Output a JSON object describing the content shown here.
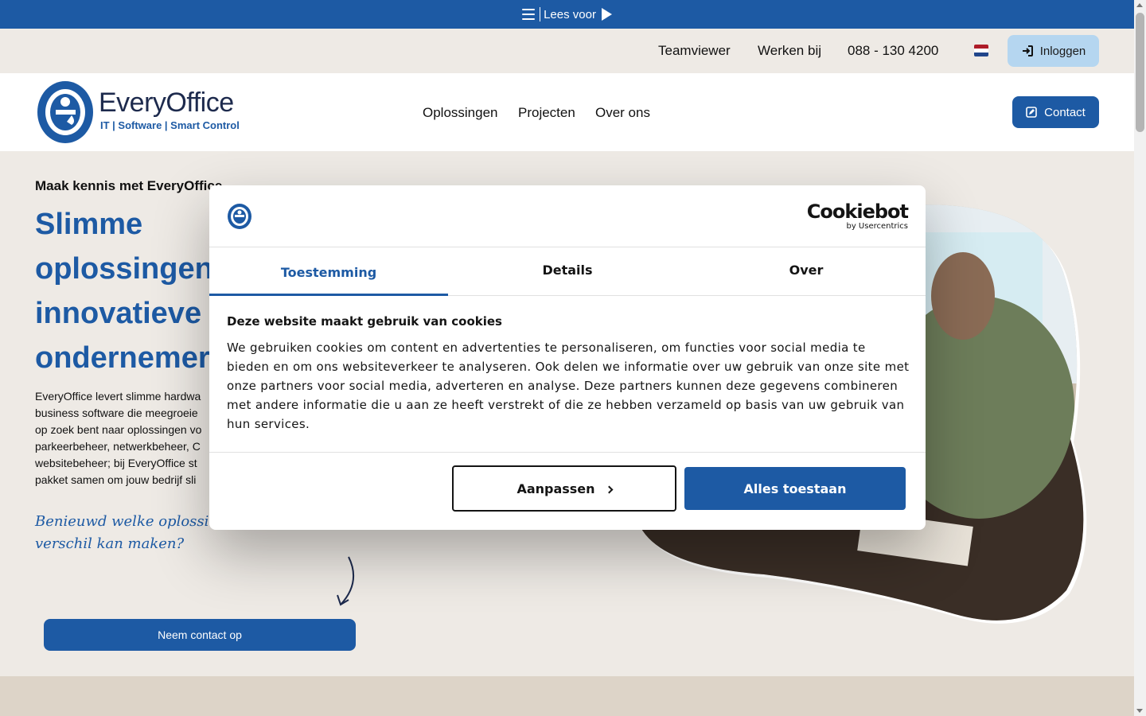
{
  "readbar": {
    "label": "Lees voor"
  },
  "utility": {
    "links": [
      "Teamviewer",
      "Werken bij",
      "088 - 130 4200"
    ],
    "login_label": "Inloggen",
    "flag_colors": [
      "#ae1c28",
      "#ffffff",
      "#21468b"
    ]
  },
  "header": {
    "logo_name": "EveryOffice",
    "logo_tagline": "IT | Software | Smart Control",
    "nav": [
      "Oplossingen",
      "Projecten",
      "Over ons"
    ],
    "contact_label": "Contact"
  },
  "hero": {
    "kicker": "Maak kennis met EveryOffice",
    "title_lines": [
      "Slimme",
      "oplossingen",
      "innovatieve",
      "ondernemer"
    ],
    "body_lines": [
      "EveryOffice levert slimme hardwa",
      "business software die meegroeie",
      "op zoek bent naar oplossingen vo",
      "parkeerbeheer, netwerkbeheer, C",
      "websitebeheer; bij EveryOffice st",
      "pakket samen om jouw bedrijf sli"
    ],
    "handwritten_lines": [
      "Benieuwd welke oplossing v",
      "verschil kan maken?"
    ],
    "cta_label": "Neem contact op"
  },
  "cookie_dialog": {
    "brand_main": "Cookiebot",
    "brand_sub": "by Usercentrics",
    "tabs": [
      "Toestemming",
      "Details",
      "Over"
    ],
    "heading": "Deze website maakt gebruik van cookies",
    "body": "We gebruiken cookies om content en advertenties te personaliseren, om functies voor social media te bieden en om ons websiteverkeer te analyseren. Ook delen we informatie over uw gebruik van onze site met onze partners voor social media, adverteren en analyse. Deze partners kunnen deze gegevens combineren met andere informatie die u aan ze heeft verstrekt of die ze hebben verzameld op basis van uw gebruik van hun services.",
    "customize_label": "Aanpassen",
    "accept_label": "Alles toestaan"
  },
  "colors": {
    "brand_blue": "#1d5aa4",
    "navy": "#1d2a4d",
    "login_bg": "#b5d6f0",
    "hero_bg": "#eeeae5"
  }
}
